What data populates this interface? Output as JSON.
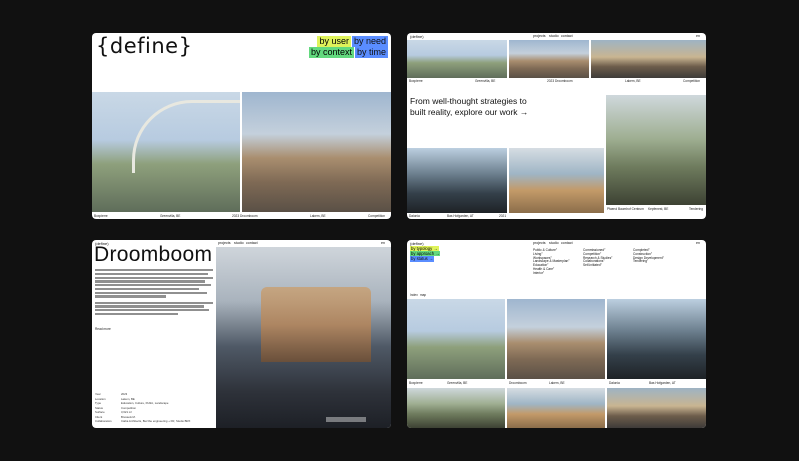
{
  "panel1": {
    "logo": "{define}",
    "tags": [
      "by user",
      "by need",
      "by context",
      "by time"
    ],
    "captions": [
      {
        "name": "Boxpierre",
        "place": ""
      },
      {
        "name": "Greenvilla, BE",
        "place": ""
      },
      {
        "name": "2023 Droomboom",
        "place": ""
      },
      {
        "name": "Lakem, BE",
        "place": ""
      },
      {
        "name": "Competition",
        "place": ""
      }
    ]
  },
  "panel2": {
    "logo": "(define)",
    "nav": [
      "projects",
      "studio",
      "contact"
    ],
    "lang": "en",
    "top_captions": [
      "Boxpierre",
      "Greenvilla, BE",
      "2023 Droomboom",
      "Lakem, BE",
      "Competition"
    ],
    "headline_1": "From well-thought strategies to",
    "headline_2": "built reality, explore our work →",
    "bottom_captions": [
      "Dalonia",
      "Bas Hofgarden, AT",
      "2021"
    ],
    "right_captions": [
      "Pfaend Baumhof Centrum",
      "Kepfenest, BE",
      "Tendering"
    ]
  },
  "panel3": {
    "logo": "(define)",
    "nav": [
      "projects",
      "studio",
      "contact"
    ],
    "lang": "en",
    "title": "Droomboom",
    "read_more": "Read more",
    "meta": [
      {
        "k": "Year",
        "v": "2023"
      },
      {
        "k": "Location",
        "v": "Lakem, BE"
      },
      {
        "k": "Type",
        "v": "Education, Culture, Public, Landscape"
      },
      {
        "k": "Status",
        "v": "Competition"
      },
      {
        "k": "Surface",
        "v": "3,621 m²"
      },
      {
        "k": "Client",
        "v": "Brussels M."
      },
      {
        "k": "Collaborators",
        "v": "Ciaba Architects, Buzzbe engineering + FR, Studio BRX"
      }
    ]
  },
  "panel4": {
    "logo": "(define)",
    "nav": [
      "projects",
      "studio",
      "contact"
    ],
    "lang": "en",
    "filters": [
      "by typology →",
      "by approach →",
      "by status →"
    ],
    "col1": [
      "Public & Culture°",
      "Living°",
      "Workspaces°",
      "Landscape & Masterplan°",
      "Education°",
      "Health & Care°",
      "Interior°"
    ],
    "col2": [
      "Commissioned°",
      "Competition°",
      "Research & Studies°",
      "Collaborations°",
      "Self-initiated°"
    ],
    "col3": [
      "Completed°",
      "Construction°",
      "Design Development°",
      "Tendering°"
    ],
    "view_toggle": [
      "Index",
      "map"
    ],
    "captions": [
      "Boxpierre",
      "Greenvilla, BE",
      "Droomboom",
      "Lakem, BE",
      "Dalonia",
      "Bas Hofgarden, AT"
    ]
  },
  "colors": {
    "background": "#111111",
    "tag_yellow": "#dff35a",
    "tag_blue": "#5a8dff",
    "tag_green": "#63d97e"
  }
}
